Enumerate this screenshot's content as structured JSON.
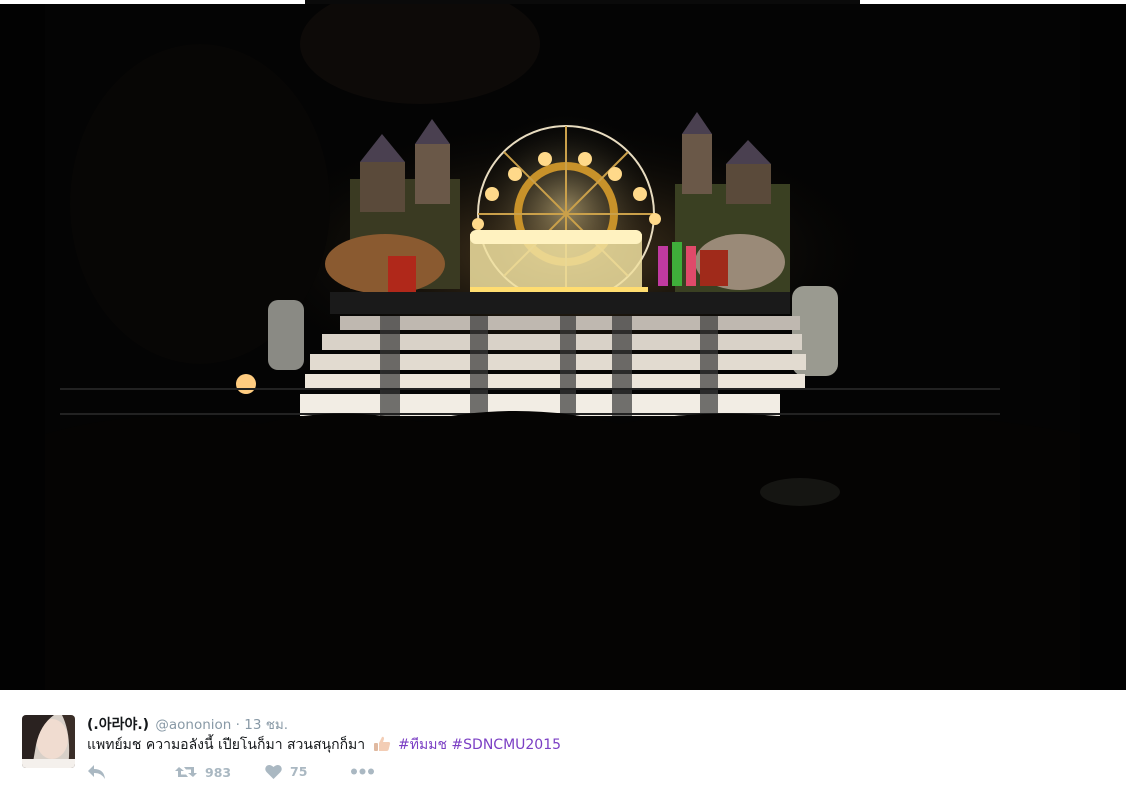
{
  "photo": {
    "icon": "night-stage-photo",
    "accent_colors": {
      "lights": "#f5d27a",
      "night": "#000000",
      "performers": "#e8e2da"
    }
  },
  "tweet": {
    "author": {
      "display_name": "(.아라야.)",
      "screen_name": "@aononion",
      "separator": "·",
      "time": "13 ชม."
    },
    "text": "แพทย์มช ความอลังนี้ เปียโนก็มา สวนสนุกก็มา",
    "emoji_icon": "thumbs-up-emoji",
    "hashtags": [
      "#ทีมมช",
      "#SDNCMU2015"
    ],
    "actions": {
      "reply_icon": "reply-icon",
      "retweet_icon": "retweet-icon",
      "retweet_count": "983",
      "like_icon": "heart-icon",
      "like_count": "75",
      "more_icon": "more-icon"
    },
    "colors": {
      "hashtag": "#7b3fc4",
      "muted": "#8899a6",
      "icon": "#aab8c2"
    }
  }
}
